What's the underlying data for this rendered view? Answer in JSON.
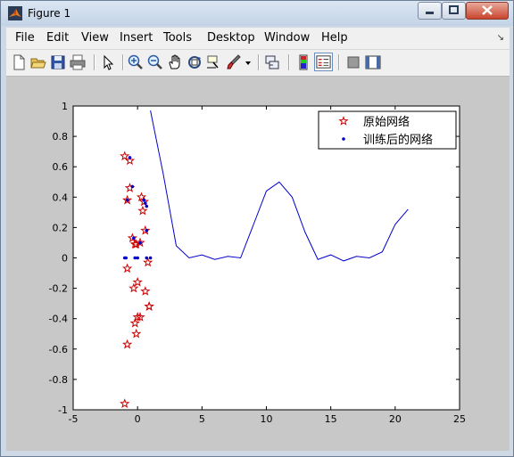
{
  "window": {
    "title": "Figure 1"
  },
  "menu": [
    "File",
    "Edit",
    "View",
    "Insert",
    "Tools",
    "Desktop",
    "Window",
    "Help"
  ],
  "menu_arrow": "↘",
  "toolbar_icons": [
    "new-figure-icon",
    "open-file-icon",
    "save-icon",
    "print-icon",
    "edit-plot-arrow-icon",
    "zoom-in-icon",
    "zoom-out-icon",
    "pan-hand-icon",
    "rotate-3d-icon",
    "data-cursor-icon",
    "brush-icon",
    "brush-dropdown-icon",
    "link-plot-icon",
    "insert-colorbar-icon",
    "insert-legend-icon",
    "hide-plot-tools-icon",
    "show-plot-tools-icon"
  ],
  "chart_data": {
    "type": "scatter",
    "title": "",
    "xlabel": "",
    "ylabel": "",
    "xlim": [
      -5,
      25
    ],
    "ylim": [
      -1,
      1
    ],
    "xticks": [
      "-5",
      "0",
      "5",
      "10",
      "15",
      "20",
      "25"
    ],
    "yticks": [
      "-1",
      "-0.8",
      "-0.6",
      "-0.4",
      "-0.2",
      "0",
      "0.2",
      "0.4",
      "0.6",
      "0.8",
      "1"
    ],
    "grid": false,
    "legend_position": "top-right",
    "series": [
      {
        "name": "原始网络",
        "marker": "pentagram",
        "color": "#cc0000",
        "x": [
          -1.0,
          -0.6,
          -0.8,
          -0.6,
          -0.4,
          -0.2,
          -0.1,
          0.3,
          0.5,
          0.6,
          0.8,
          0.4,
          0.2,
          0.0,
          -0.3,
          -0.8,
          0.2,
          0.6,
          0.9,
          0.9,
          0.0,
          -0.2,
          -0.1,
          -0.8,
          -1.0
        ],
        "y": [
          0.67,
          0.64,
          0.38,
          0.46,
          0.13,
          0.09,
          0.09,
          0.4,
          0.37,
          0.18,
          -0.03,
          0.31,
          0.1,
          -0.16,
          -0.2,
          -0.07,
          -0.39,
          -0.22,
          -0.32,
          -0.32,
          -0.39,
          -0.43,
          -0.5,
          -0.57,
          -0.96
        ]
      },
      {
        "name": "训练后的网络",
        "marker": "dot",
        "color": "#0000cc",
        "x": [
          -0.6,
          -0.8,
          -0.4,
          -0.3,
          0.6,
          0.5,
          0.7,
          0.7,
          0.2,
          -1.0,
          -0.9,
          -0.2,
          0.0,
          0.7,
          1.0
        ],
        "y": [
          0.66,
          0.38,
          0.47,
          0.13,
          0.36,
          0.38,
          0.34,
          0.18,
          0.1,
          0.0,
          0.0,
          0.0,
          0.0,
          0.0,
          0.0
        ]
      },
      {
        "name": "",
        "type": "line",
        "color": "#0000cc",
        "x": [
          1,
          2,
          3,
          4,
          5,
          6,
          7,
          8,
          9,
          10,
          11,
          12,
          13,
          14,
          15,
          16,
          17,
          18,
          19,
          20,
          21
        ],
        "y": [
          0.97,
          0.55,
          0.08,
          0.0,
          0.02,
          -0.01,
          0.01,
          0.0,
          0.22,
          0.44,
          0.5,
          0.4,
          0.17,
          -0.01,
          0.02,
          -0.02,
          0.01,
          0.0,
          0.04,
          0.22,
          0.32
        ]
      }
    ]
  }
}
